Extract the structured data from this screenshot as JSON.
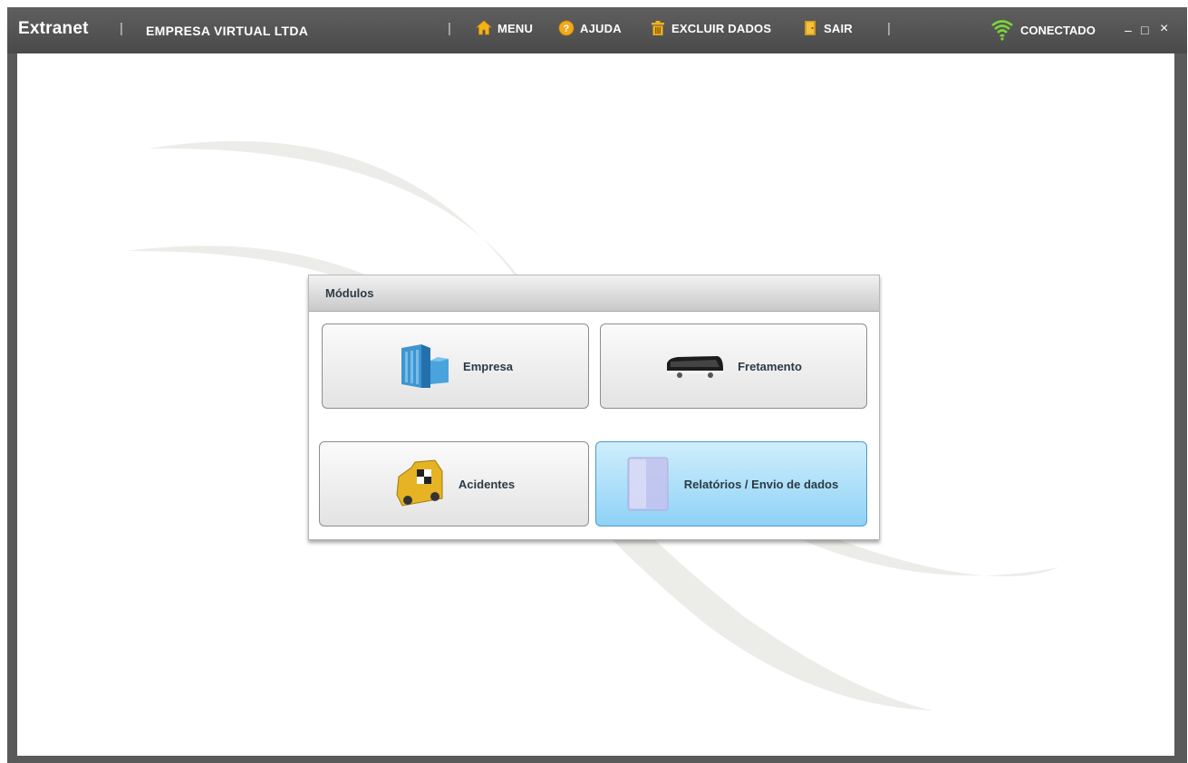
{
  "titlebar": {
    "app_title": "Extranet",
    "separator": "|",
    "company": "EMPRESA VIRTUAL LTDA",
    "nav": {
      "menu": "MENU",
      "help": "AJUDA",
      "delete_data": "EXCLUIR DADOS",
      "exit": "SAIR"
    },
    "status": "CONECTADO",
    "controls": {
      "minimize": "–",
      "maximize": "□",
      "close": "×"
    }
  },
  "panel": {
    "title": "Módulos",
    "modules": {
      "empresa": "Empresa",
      "fretamento": "Fretamento",
      "acidentes": "Acidentes",
      "relatorios": "Relatórios / Envio de dados"
    }
  },
  "colors": {
    "titlebar": "#555555",
    "active_module": "#a6dcf8",
    "status_signal": "#7bd43a"
  }
}
